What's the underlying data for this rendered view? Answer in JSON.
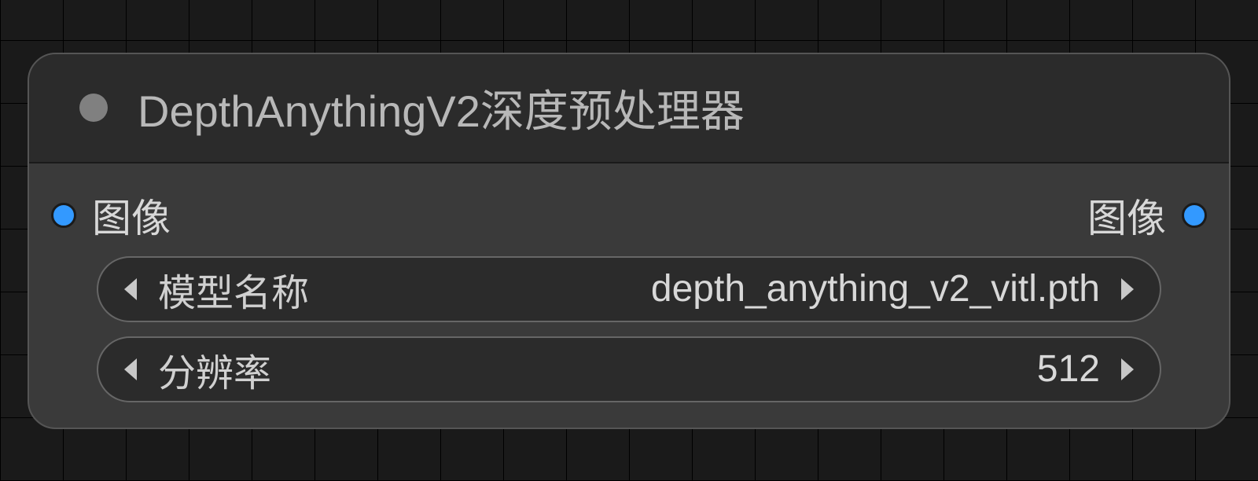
{
  "node": {
    "title": "DepthAnythingV2深度预处理器",
    "input": {
      "image_label": "图像"
    },
    "output": {
      "image_label": "图像"
    },
    "widgets": {
      "model": {
        "label": "模型名称",
        "value": "depth_anything_v2_vitl.pth"
      },
      "resolution": {
        "label": "分辨率",
        "value": "512"
      }
    }
  },
  "colors": {
    "port_accent": "#3399ff"
  }
}
